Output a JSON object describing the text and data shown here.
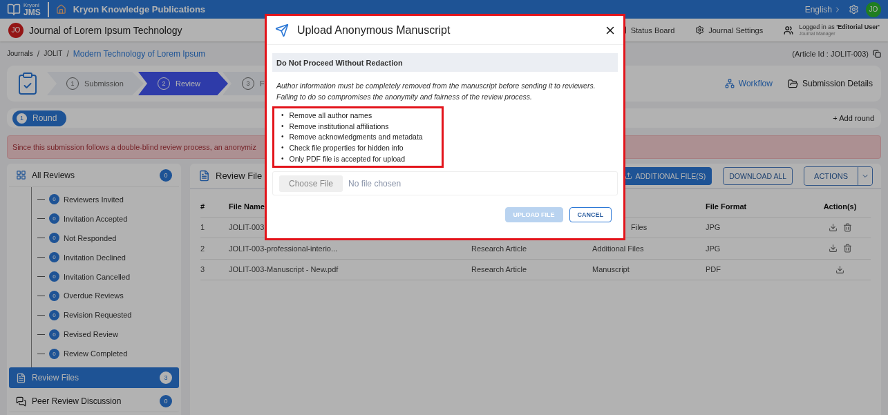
{
  "top_bar": {
    "logo_small": "Kryoni",
    "logo_large": "JMS",
    "publisher": "Kryon Knowledge Publications",
    "language": "English",
    "avatar": "JO"
  },
  "journal_bar": {
    "avatar": "JO",
    "title": "Journal of Lorem Ipsum Technology",
    "links": [
      "Status Board",
      "Journal Settings"
    ],
    "user": {
      "line": "Logged in as **'Editorial User'**",
      "role": "Journal Manager"
    }
  },
  "breadcrumb": [
    {
      "label": "Journals",
      "current": false
    },
    {
      "separator": "/",
      "label": "JOLIT",
      "current": false
    },
    {
      "separator": "/",
      "label": "Modern Technology of Lorem Ipsum",
      "current": true
    }
  ],
  "article_id": "(Article Id : JOLIT-003)",
  "stepper": {
    "steps": [
      {
        "number": "1",
        "label": "Submission",
        "selected": false
      },
      {
        "number": "2",
        "label": "Review",
        "selected": true
      },
      {
        "number": "3",
        "label": "F",
        "selected": false
      }
    ],
    "links": [
      {
        "label": "Workflow",
        "selected": true
      },
      {
        "label": "Submission Details",
        "selected": false
      }
    ]
  },
  "rounds": {
    "tabs": [
      {
        "number": "1",
        "label": "Round",
        "selected": true
      }
    ],
    "add": "+ Add round"
  },
  "alert": "Since this submission follows a double-blind review process, an anonymiz",
  "sidebar": {
    "header": {
      "label": "All Reviews",
      "count": "0"
    },
    "items": [
      {
        "count": "0",
        "label": "Reviewers Invited"
      },
      {
        "count": "0",
        "label": "Invitation Accepted"
      },
      {
        "count": "0",
        "label": "Not Responded"
      },
      {
        "count": "0",
        "label": "Invitation Declined"
      },
      {
        "count": "0",
        "label": "Invitation Cancelled"
      },
      {
        "count": "0",
        "label": "Overdue Reviews"
      },
      {
        "count": "0",
        "label": "Revision Requested"
      },
      {
        "count": "0",
        "label": "Revised Review"
      },
      {
        "count": "0",
        "label": "Review Completed"
      }
    ],
    "sections": [
      {
        "label": "Review Files",
        "count": "3",
        "selected": true
      },
      {
        "label": "Peer Review Discussion",
        "count": "0",
        "selected": false
      }
    ]
  },
  "files_panel": {
    "title": "Review File",
    "buttons": [
      {
        "label": "ADDITIONAL FILE(S)",
        "kind": "primary"
      },
      {
        "label": "DOWNLOAD ALL",
        "kind": "outline"
      },
      {
        "label": "ACTIONS",
        "kind": "split"
      }
    ],
    "table": {
      "columns": {
        "number": "#",
        "file_name": "File Name",
        "file_format": "File Format",
        "actions": "Action(s)"
      },
      "rows": [
        {
          "number": "1",
          "file_name": "JOLIT-003",
          "category": "Files",
          "category_cut": true,
          "file_format": "JPG",
          "deletable": true
        },
        {
          "number": "2",
          "file_name": "JOLIT-003-professional-interio...",
          "type": "Research Article",
          "category": "Additional Files",
          "category_cut": false,
          "file_format": "JPG",
          "deletable": true
        },
        {
          "number": "3",
          "file_name": "JOLIT-003-Manuscript - New.pdf",
          "type": "Research Article",
          "category": "Manuscript",
          "category_cut": false,
          "file_format": "PDF",
          "deletable": false
        }
      ]
    }
  },
  "modal": {
    "title": "Upload Anonymous Manuscript",
    "notice": "Do Not Proceed Without Redaction",
    "message": "Author information must be completely removed from the manuscript before sending it to reviewers. Failing to do so compromises the anonymity and fairness of the review process.",
    "checklist": [
      {
        "bullet": "•",
        "text": "Remove all author names"
      },
      {
        "bullet": "•",
        "text": "Remove institutional affiliations"
      },
      {
        "bullet": "•",
        "text": "Remove acknowledgments and metadata"
      },
      {
        "bullet": "•",
        "text": "Check file properties for hidden info"
      },
      {
        "bullet": "•",
        "text": "Only PDF file is accepted for upload"
      }
    ],
    "file_input": {
      "button": "Choose File",
      "placeholder": "No file chosen"
    },
    "buttons": [
      {
        "label": "UPLOAD FILE",
        "disabled": true
      },
      {
        "label": "CANCEL",
        "disabled": false
      }
    ]
  }
}
